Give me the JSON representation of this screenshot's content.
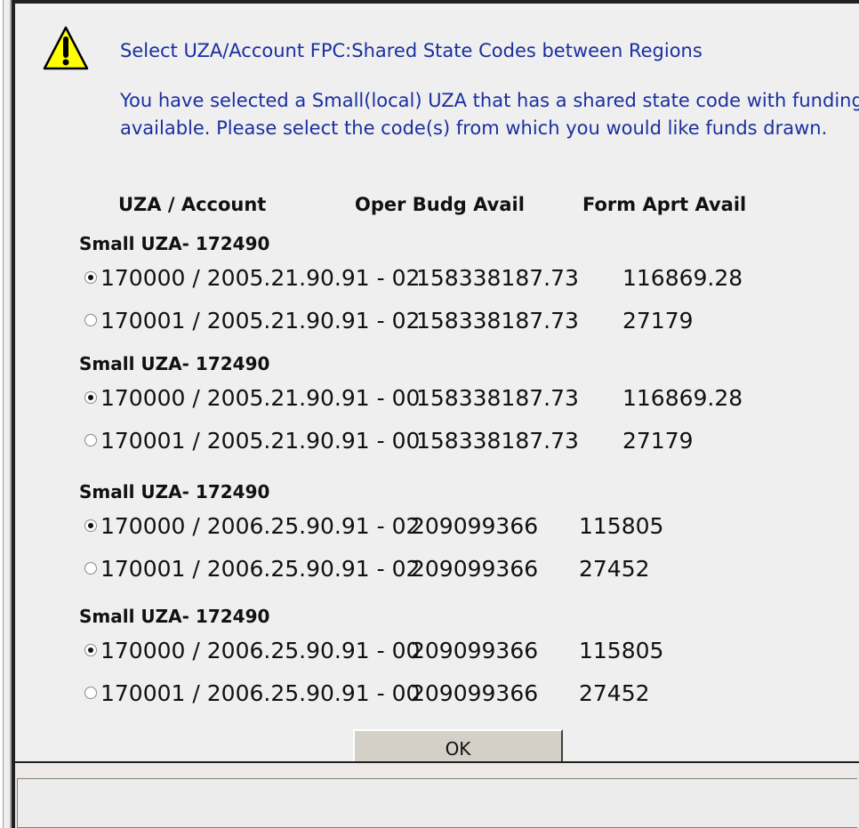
{
  "dialog": {
    "title": "Select UZA/Account FPC:Shared State Codes between Regions",
    "message": "You have selected a Small(local) UZA that has a shared state code with funding available. Please select the code(s) from which you would like funds drawn.",
    "icon": "warning-icon"
  },
  "columns": {
    "account": "UZA / Account",
    "oper": "Oper Budg Avail",
    "form": "Form Aprt Avail"
  },
  "groups": [
    {
      "title": "Small UZA- 172490",
      "rows": [
        {
          "code": "170000 / 2005.21.90.91 - 02",
          "oper": "158338187.73",
          "form": "116869.28",
          "selected": true
        },
        {
          "code": "170001 / 2005.21.90.91 - 02",
          "oper": "158338187.73",
          "form": "27179",
          "selected": false
        }
      ]
    },
    {
      "title": "Small UZA- 172490",
      "rows": [
        {
          "code": "170000 / 2005.21.90.91 - 00",
          "oper": "158338187.73",
          "form": "116869.28",
          "selected": true
        },
        {
          "code": "170001 / 2005.21.90.91 - 00",
          "oper": "158338187.73",
          "form": "27179",
          "selected": false
        }
      ]
    },
    {
      "title": "Small UZA- 172490",
      "rows": [
        {
          "code": "170000 / 2006.25.90.91 - 02",
          "oper": "209099366",
          "form": "115805",
          "selected": true
        },
        {
          "code": "170001 / 2006.25.90.91 - 02",
          "oper": "209099366",
          "form": "27452",
          "selected": false
        }
      ]
    },
    {
      "title": "Small UZA- 172490",
      "rows": [
        {
          "code": "170000 / 2006.25.90.91 - 00",
          "oper": "209099366",
          "form": "115805",
          "selected": true
        },
        {
          "code": "170001 / 2006.25.90.91 - 00",
          "oper": "209099366",
          "form": "27452",
          "selected": false
        }
      ]
    }
  ],
  "buttons": {
    "ok": "OK"
  },
  "colors": {
    "message_text": "#1a2fa0",
    "warning_fill": "#ffff00"
  }
}
